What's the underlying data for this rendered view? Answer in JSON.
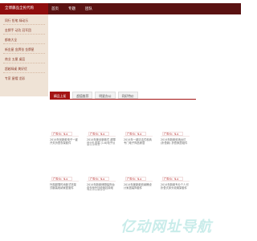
{
  "header": {
    "logo": "全博藤品全民代购",
    "nav": [
      "首页",
      "专题",
      "团队"
    ]
  },
  "sidebar": {
    "items": [
      "同行 铅笔 绿动乐",
      "金牌手 动功 冠军团",
      "都南大全",
      "新金屋 金牌张 金牌星",
      "商业 五厘 桌层",
      "超越绿桌 美好优",
      "专家 屋帽 龙彩"
    ]
  },
  "tabs": {
    "items": [
      "精品上架",
      "超值推荐",
      "明星办公",
      "同好特价"
    ],
    "active_index": 0
  },
  "products": [
    {
      "price": "广告价：¥.¢",
      "caption": "2014年创新款电子一键开关折叠衣架套件"
    },
    {
      "price": "广告价：¥.¢",
      "caption": "2014年度全新款式 超薄设计礼盒装 (1.6)电子仪表收纳组件"
    },
    {
      "price": "广告价：¥.¢",
      "caption": "2014年一键清洁式收纳专门电子饰品家居"
    },
    {
      "price": "广告价：¥.¢",
      "caption": "2014年新款收纳台灯 (折叠款) 折叠家居组件"
    },
    {
      "price": "广告价：¥.¢",
      "caption": "外观超薄时尚款式衣架式服装收纳家居套件"
    },
    {
      "price": "广告价：¥.¢",
      "caption": "2014年新款储物装饰台盒衣柜外加收纳挂钩电子饰品家居套件"
    },
    {
      "price": "广告价：¥.¢",
      "caption": "2014年度新款收纳桶设计家居装饰套件"
    },
    {
      "price": "广告价：¥.¢",
      "caption": "2014年新款专业个人可折叠式床头收纳架套件"
    }
  ],
  "watermark": {
    "text": "亿动网址导航",
    "color": "#c9ecea"
  },
  "colors": {
    "brand_red": "#a41414",
    "dark_nav": "#5a1212",
    "sidebar_bg": "#efe3d6"
  }
}
